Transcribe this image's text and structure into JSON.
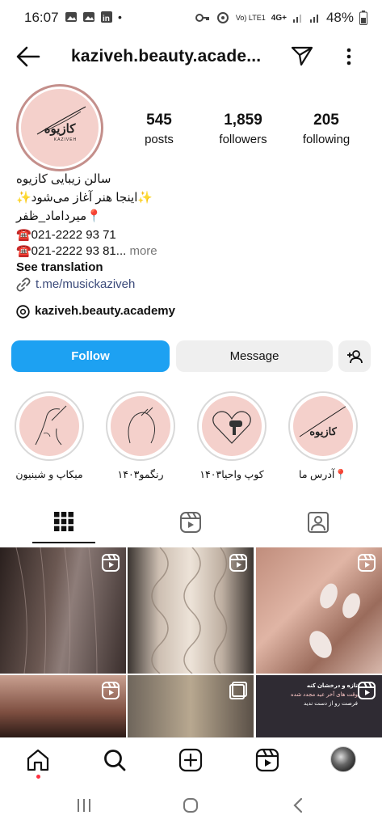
{
  "status_bar": {
    "time": "16:07",
    "battery": "48%",
    "network_label": "4G+",
    "volte": "Vo) LTE1"
  },
  "header": {
    "username": "kaziveh.beauty.acade..."
  },
  "profile": {
    "avatar_text": "کازیوه",
    "avatar_sub": "KAZIVEH",
    "stats": [
      {
        "number": "545",
        "label": "posts"
      },
      {
        "number": "1,859",
        "label": "followers"
      },
      {
        "number": "205",
        "label": "following"
      }
    ],
    "bio": {
      "line1": "سالن زیبایی کازیوه",
      "line2": "✨اینجا هنر آغاز می‌شود✨",
      "line3": "📍میرداماد_ظفر",
      "phone1": "☎️021-2222 93 71",
      "phone2": "☎️021-2222 93 81...",
      "more": " more",
      "see_translation": "See translation",
      "link": "t.me/musickaziveh",
      "threads": "kaziveh.beauty.academy"
    }
  },
  "actions": {
    "follow": "Follow",
    "message": "Message"
  },
  "highlights": [
    {
      "label": "میکاپ و شینیون"
    },
    {
      "label": "رنگمو۱۴۰۳"
    },
    {
      "label": "کوپ واحیا۱۴۰۳"
    },
    {
      "label": "📍آدرس ما"
    }
  ],
  "colors": {
    "follow_blue": "#1da1f2",
    "pink": "#f4d0cb",
    "brand_ring": "#c48f8b"
  },
  "grid_overlay_text": {
    "line1": "تازه و درخشان کنه",
    "line2": "وقت های آخر عید مجدد شده",
    "line3": "فرصت رو از دست ندید"
  }
}
